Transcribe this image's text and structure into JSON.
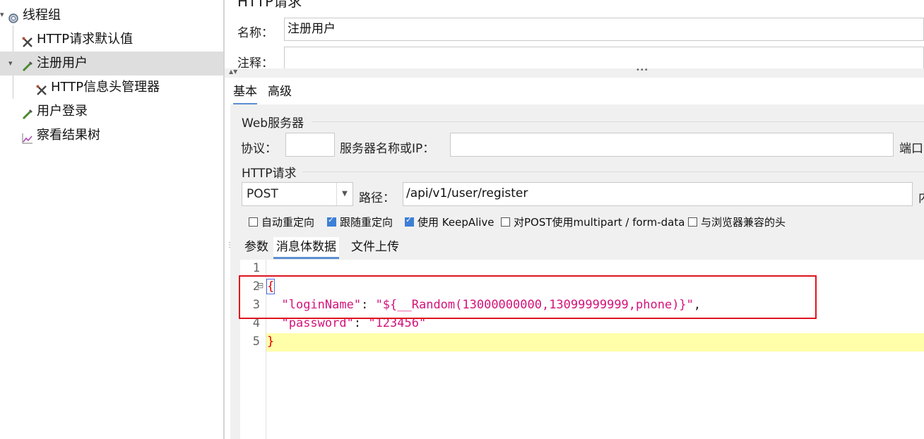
{
  "tree": {
    "items": [
      {
        "label": "线程组",
        "icon": "gear-icon",
        "expanded": true
      },
      {
        "label": "HTTP请求默认值",
        "icon": "wrench-icon"
      },
      {
        "label": "注册用户",
        "icon": "pipette-icon",
        "selected": true,
        "expanded": true
      },
      {
        "label": "HTTP信息头管理器",
        "icon": "wrench-icon"
      },
      {
        "label": "用户登录",
        "icon": "pipette-icon"
      },
      {
        "label": "察看结果树",
        "icon": "chart-icon"
      }
    ]
  },
  "panel": {
    "title": "HTTP请求",
    "name_label": "名称：",
    "name_value": "注册用户",
    "comment_label": "注释：",
    "comment_value": "",
    "tabs": [
      "基本",
      "高级"
    ],
    "web_server": {
      "section": "Web服务器",
      "protocol_label": "协议：",
      "protocol_value": "",
      "server_label": "服务器名称或IP：",
      "server_value": "",
      "port_label": "端口"
    },
    "http_request": {
      "section": "HTTP请求",
      "method": "POST",
      "path_label": "路径：",
      "path_value": "/api/v1/user/register",
      "encoding_label": "内"
    },
    "options": [
      {
        "label": "自动重定向",
        "checked": false
      },
      {
        "label": "跟随重定向",
        "checked": true
      },
      {
        "label": "使用 KeepAlive",
        "checked": true
      },
      {
        "label": "对POST使用multipart / form-data",
        "checked": false
      },
      {
        "label": "与浏览器兼容的头",
        "checked": false
      }
    ],
    "body_tabs": [
      "参数",
      "消息体数据",
      "文件上传"
    ],
    "active_body_tab": "消息体数据"
  },
  "editor": {
    "line_numbers": [
      "1",
      "2",
      "3",
      "4",
      "5"
    ],
    "fold_marker": "⊟",
    "lines": {
      "l2_brace": "{",
      "l3_key": "\"loginName\"",
      "l3_sep": ": ",
      "l3_value": "\"${__Random(13000000000,13099999999,phone)}\"",
      "l3_tail": ",",
      "l4_key": "\"password\"",
      "l4_sep": ": ",
      "l4_value": "\"123456\"",
      "l5_brace": "}"
    }
  },
  "colors": {
    "highlight_box": "#e0141e",
    "key_color": "#d4137b",
    "brace_color": "#e00000",
    "current_line": "#ffffaa"
  }
}
